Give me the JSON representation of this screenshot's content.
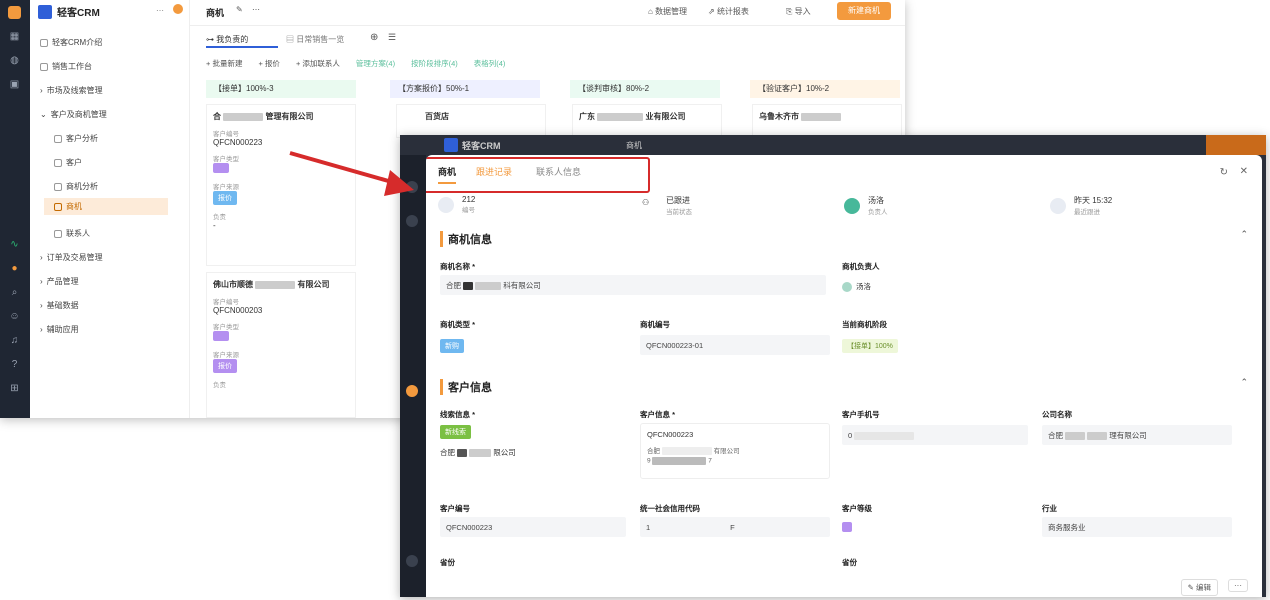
{
  "bg": {
    "brand": "轻客CRM",
    "nav": [
      "轻客CRM介绍",
      "销售工作台",
      "市场及线索管理",
      "客户及商机管理",
      "客户分析",
      "客户",
      "商机分析",
      "商机",
      "联系人",
      "订单及交易管理",
      "产品管理",
      "基础数据",
      "辅助应用"
    ],
    "title": "商机",
    "toolbar": [
      "数据管理",
      "统计报表",
      "导入",
      "新建商机"
    ],
    "views": [
      "我负责的",
      "日常销售一览"
    ],
    "actions": [
      "+ 批量新建",
      "+ 报价",
      "+ 添加联系人",
      "管理方案(4)",
      "按阶段排序(4)",
      "表格列(4)"
    ],
    "columns": [
      "【接单】100%-3",
      "【方案报价】50%-1",
      "【谈判审核】80%-2",
      "【验证客户】10%-2"
    ],
    "card1": {
      "name_start": "合",
      "name_end": "管理有限公司",
      "code_label": "客户编号",
      "code": "QFCN000223",
      "type_label": "客户类型",
      "source_label": "客户来源",
      "tag2": "报价",
      "owner_label": "负责",
      "owner": "-"
    },
    "card2": {
      "name_start": "佛山市顺德",
      "name_end": "有限公司",
      "code_label": "客户编号",
      "code": "QFCN000203",
      "type_label": "客户类型",
      "source_label": "客户来源",
      "tag2": "报价",
      "owner_label": "负责"
    },
    "col2_card": {
      "name": "百货店"
    },
    "col3_card": {
      "name_start": "广东",
      "name_end": "业有限公司"
    },
    "col4_card": {
      "name": "乌鲁木齐市"
    }
  },
  "modal": {
    "brand": "轻客CRM",
    "title": "商机",
    "tabs": [
      "商机",
      "跟进记录",
      "联系人信息"
    ],
    "stats": [
      {
        "v": "212",
        "l": "编号"
      },
      {
        "v": "已跟进",
        "l": "当前状态"
      },
      {
        "v": "汤洛",
        "l": "负责人"
      },
      {
        "v": "昨天 15:32",
        "l": "最近跟进"
      }
    ],
    "sec1": "商机信息",
    "f_name": "商机名称 *",
    "v_name_start": "合肥",
    "v_name_end": "科有限公司",
    "f_owner": "商机负责人",
    "v_owner": "汤洛",
    "f_type": "商机类型 *",
    "v_type": "新购",
    "f_code": "商机编号",
    "v_code": "QFCN000223-01",
    "f_stage": "当前商机阶段",
    "v_stage": "【接单】100%",
    "sec2": "客户信息",
    "f_lead": "线索信息 *",
    "v_lead_tag": "新线索",
    "v_lead_a": "合肥",
    "v_lead_b": "限公司",
    "f_cust": "客户信息 *",
    "v_cust_code": "QFCN000223",
    "v_cust_a": "合肥",
    "v_cust_b": "有限公司",
    "v_cust_c": "9",
    "v_cust_d": "7",
    "f_phone": "客户手机号",
    "v_phone": "0",
    "f_company": "公司名称",
    "v_company_a": "合肥",
    "v_company_b": "理有限公司",
    "f_cno": "客户编号",
    "v_cno": "QFCN000223",
    "f_credit": "统一社会信用代码",
    "v_credit_a": "1",
    "v_credit_b": "F",
    "f_level": "客户等级",
    "f_industry": "行业",
    "v_industry": "商务服务业",
    "f_region": "省份",
    "f_addr": "省份",
    "edit": "编辑",
    "more": "···"
  }
}
